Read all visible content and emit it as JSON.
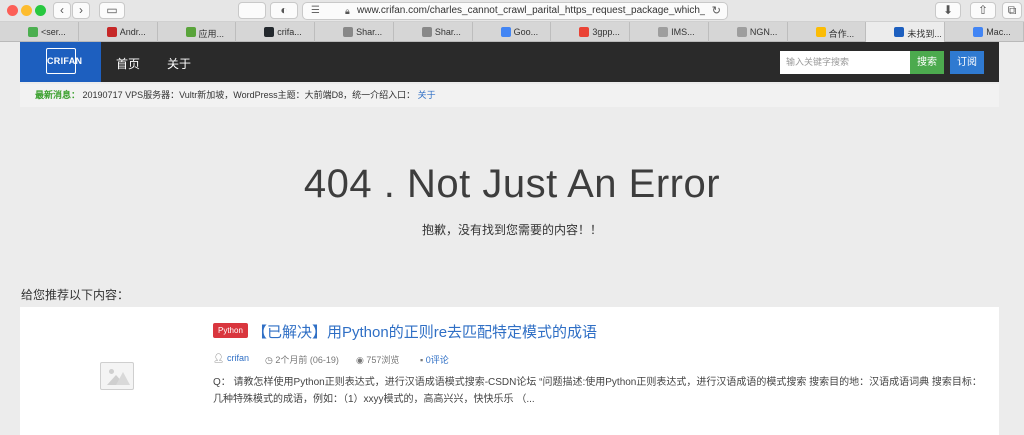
{
  "browser": {
    "url": "www.crifan.com/charles_cannot_crawl_parital_https_request_package_which_using",
    "tabs": [
      {
        "label": "<ser...",
        "icon_color": "#4caf50"
      },
      {
        "label": "Andr...",
        "icon_color": "#c62828"
      },
      {
        "label": "应用...",
        "icon_color": "#5aa43b"
      },
      {
        "label": "crifa...",
        "icon_color": "#24292e"
      },
      {
        "label": "Shar...",
        "icon_color": "#888888"
      },
      {
        "label": "Shar...",
        "icon_color": "#888888"
      },
      {
        "label": "Goo...",
        "icon_color": "#4285f4"
      },
      {
        "label": "3gpp...",
        "icon_color": "#ea4335"
      },
      {
        "label": "IMS...",
        "icon_color": "#9e9e9e"
      },
      {
        "label": "NGN...",
        "icon_color": "#9e9e9e"
      },
      {
        "label": "合作...",
        "icon_color": "#fbbc05"
      },
      {
        "label": "未找到...",
        "icon_color": "#1d5fbf"
      },
      {
        "label": "Mac...",
        "icon_color": "#4285f4"
      }
    ],
    "active_tab_index": 11
  },
  "header": {
    "logo_text": "CRIFAN",
    "nav": [
      "首页",
      "关于"
    ],
    "search_placeholder": "输入关键字搜索",
    "search_button": "搜索",
    "subscribe_button": "订阅"
  },
  "news": {
    "label": "最新消息：",
    "text": "20190717 VPS服务器：Vultr新加坡，WordPress主题：大前端D8，统一介绍入口：",
    "link": "关于"
  },
  "error": {
    "title": "404 . Not Just An Error",
    "subtitle": "抱歉，没有找到您需要的内容！！"
  },
  "recommend": {
    "heading": "给您推荐以下内容：",
    "post": {
      "tag": "Python",
      "title": "【已解决】用Python的正则re去匹配特定模式的成语",
      "author": "crifan",
      "time": "2个月前 (06-19)",
      "views": "757浏览",
      "comments": "0评论",
      "excerpt": "Q： 请教怎样使用Python正则表达式，进行汉语成语模式搜索-CSDN论坛 “问题描述:使用Python正则表达式，进行汉语成语的模式搜索 搜索目的地：汉语成语词典 搜索目标：几种特殊模式的成语，例如：（1）xxyy模式的，高高兴兴，快快乐乐 （..."
    }
  }
}
